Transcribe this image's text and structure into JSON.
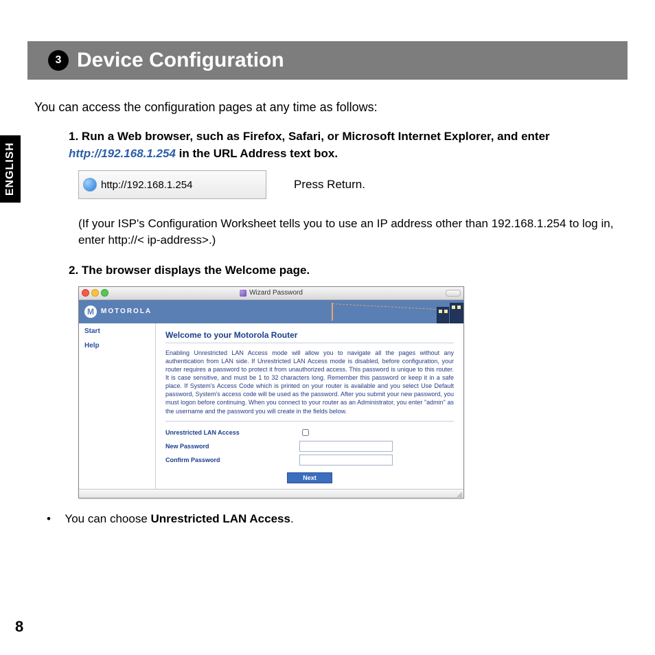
{
  "header": {
    "number": "3",
    "title": "Device Configuration"
  },
  "language_tab": "ENGLISH",
  "intro": "You can access the configuration pages at any time as follows:",
  "step1": {
    "number": "1.",
    "lead_part1": "Run a Web browser, such as Firefox, Safari, or Microsoft Internet Explorer, and enter ",
    "url": "http://192.168.1.254",
    "lead_part2": " in the URL Address text box.",
    "address_bar_text": "http://192.168.1.254",
    "press_return": "Press Return.",
    "note": "(If your ISP's Configuration Worksheet tells you to use an IP address other than 192.168.1.254 to log in, enter http://< ip-address>.)"
  },
  "step2": {
    "number": "2.",
    "lead": "The browser displays the Welcome page."
  },
  "router": {
    "window_title": "Wizard Password",
    "brand": "MOTOROLA",
    "sidebar": {
      "items": [
        {
          "label": "Start"
        },
        {
          "label": "Help"
        }
      ]
    },
    "welcome_heading": "Welcome to your Motorola Router",
    "description": "Enabling Unrestricted LAN Access mode will allow you to navigate all the pages without any authentication from LAN side. If Unrestricted LAN Access mode is disabled, before configuration, your router requires a password to protect it from unauthorized access. This password is unique to this router. It is case sensitive, and must be 1 to 32 characters long. Remember this password or keep it in a safe place. If System's Access Code which is printed on your router is available and you select Use Default password, System's access code will be used as the password. After you submit your new password, you must logon before continuing. When you connect to your router as an Administrator, you enter \"admin\" as the username and the password you will create in the fields below.",
    "form": {
      "unrestricted_label": "Unrestricted LAN Access",
      "new_password_label": "New Password",
      "confirm_password_label": "Confirm Password",
      "next_button": "Next"
    }
  },
  "bullet": {
    "prefix": "You can choose ",
    "bold": "Unrestricted LAN Access",
    "suffix": "."
  },
  "page_number": "8"
}
